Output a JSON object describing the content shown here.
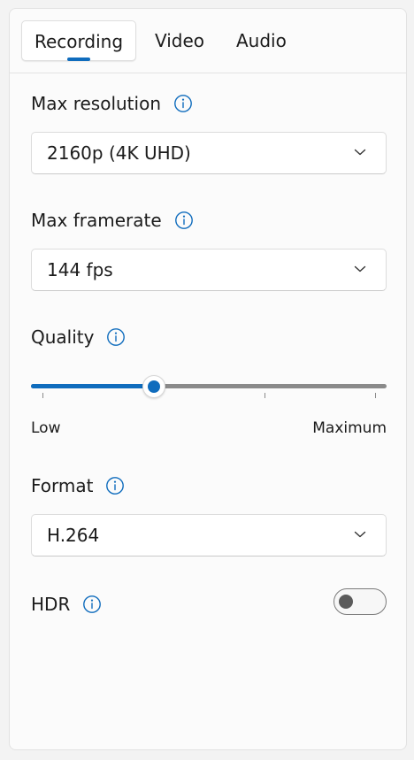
{
  "tabs": [
    {
      "label": "Recording",
      "selected": true
    },
    {
      "label": "Video",
      "selected": false
    },
    {
      "label": "Audio",
      "selected": false
    }
  ],
  "settings": {
    "max_resolution": {
      "label": "Max resolution",
      "value": "2160p (4K UHD)",
      "icon": "info-icon"
    },
    "max_framerate": {
      "label": "Max framerate",
      "value": "144 fps",
      "icon": "info-icon"
    },
    "quality": {
      "label": "Quality",
      "icon": "info-icon",
      "min_label": "Low",
      "max_label": "Maximum",
      "value_fraction": 0.345,
      "tick_count": 4
    },
    "format": {
      "label": "Format",
      "value": "H.264",
      "icon": "info-icon"
    },
    "hdr": {
      "label": "HDR",
      "icon": "info-icon",
      "enabled": false
    }
  },
  "colors": {
    "accent": "#0f6cbd",
    "info_icon": "#0f6cbd",
    "track_inactive": "#8a8a8a",
    "toggle_off_knob": "#5b5b5b"
  }
}
